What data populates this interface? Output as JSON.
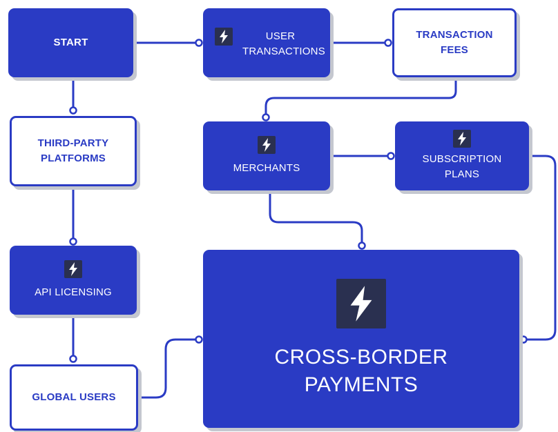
{
  "colors": {
    "primary": "#2a3bc4",
    "icon_bg": "#2a3050",
    "shadow": "#c4c7cf",
    "background": "#ffffff"
  },
  "nodes": {
    "start": {
      "label": "START"
    },
    "user_transactions": {
      "label": "USER TRANSACTIONS",
      "icon": "lightning-icon"
    },
    "transaction_fees": {
      "label": "TRANSACTION FEES"
    },
    "third_party_platforms": {
      "label": "THIRD-PARTY PLATFORMS"
    },
    "merchants": {
      "label": "MERCHANTS",
      "icon": "lightning-icon"
    },
    "subscription_plans": {
      "label": "SUBSCRIPTION PLANS",
      "icon": "lightning-icon"
    },
    "api_licensing": {
      "label": "API LICENSING",
      "icon": "lightning-icon"
    },
    "cross_border_payments": {
      "label": "CROSS-BORDER PAYMENTS",
      "icon": "lightning-icon"
    },
    "global_users": {
      "label": "GLOBAL USERS"
    }
  },
  "connections": [
    {
      "from": "start",
      "to": "user_transactions"
    },
    {
      "from": "user_transactions",
      "to": "transaction_fees"
    },
    {
      "from": "start",
      "to": "third_party_platforms"
    },
    {
      "from": "transaction_fees",
      "to": "merchants"
    },
    {
      "from": "merchants",
      "to": "subscription_plans"
    },
    {
      "from": "third_party_platforms",
      "to": "api_licensing"
    },
    {
      "from": "merchants",
      "to": "cross_border_payments"
    },
    {
      "from": "subscription_plans",
      "to": "cross_border_payments"
    },
    {
      "from": "api_licensing",
      "to": "global_users"
    },
    {
      "from": "global_users",
      "to": "cross_border_payments"
    }
  ]
}
